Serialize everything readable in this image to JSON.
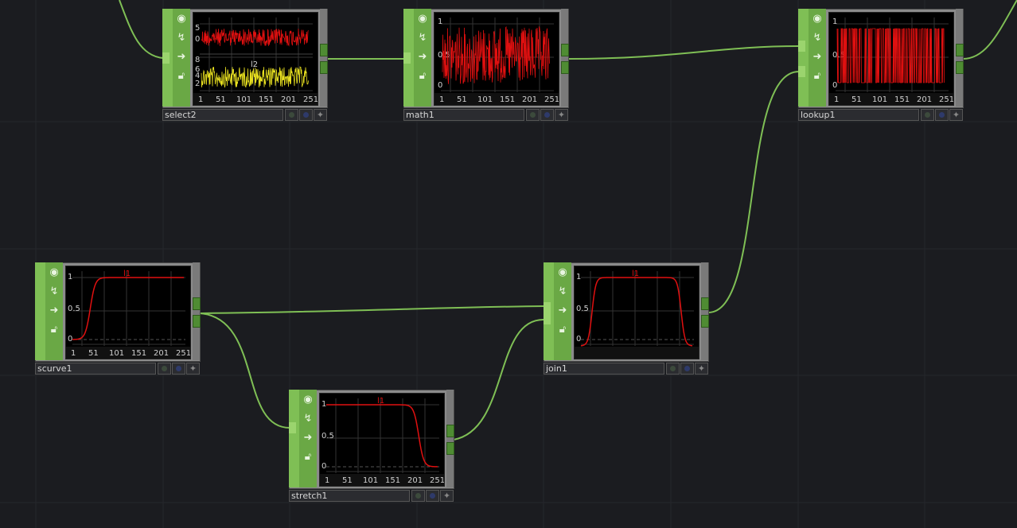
{
  "nodes": [
    {
      "id": "select2",
      "name": "select2",
      "viewer": {
        "type": "multi",
        "channel_label": "l2",
        "y_ticks_top": [
          "5",
          "0"
        ],
        "y_ticks_bottom": [
          "8",
          "6",
          "4",
          "2"
        ],
        "x_ticks": [
          "1",
          "51",
          "101",
          "151",
          "201",
          "251"
        ]
      },
      "icons": [
        "viewer-icon",
        "bypass-icon",
        "display-icon",
        "lock-icon"
      ]
    },
    {
      "id": "math1",
      "name": "math1",
      "viewer": {
        "type": "noise",
        "channel_label": "",
        "y_ticks": [
          "1",
          "0.5",
          "0"
        ],
        "x_ticks": [
          "1",
          "51",
          "101",
          "151",
          "201",
          "251"
        ]
      },
      "icons": [
        "viewer-icon",
        "bypass-icon",
        "display-icon",
        "lock-icon"
      ]
    },
    {
      "id": "lookup1",
      "name": "lookup1",
      "viewer": {
        "type": "binary",
        "channel_label": "",
        "y_ticks": [
          "1",
          "0.5",
          "0"
        ],
        "x_ticks": [
          "1",
          "51",
          "101",
          "151",
          "201",
          "251"
        ]
      },
      "icons": [
        "viewer-icon",
        "bypass-icon",
        "display-icon",
        "lock-icon"
      ]
    },
    {
      "id": "scurve1",
      "name": "scurve1",
      "viewer": {
        "type": "rise",
        "channel_label": "l1",
        "y_ticks": [
          "1",
          "0.5",
          "0"
        ],
        "x_ticks": [
          "1",
          "51",
          "101",
          "151",
          "201",
          "251"
        ]
      },
      "icons": [
        "viewer-icon",
        "bypass-icon",
        "display-icon",
        "lock-icon"
      ]
    },
    {
      "id": "join1",
      "name": "join1",
      "viewer": {
        "type": "plateau",
        "channel_label": "l1",
        "y_ticks": [
          "1",
          "0.5",
          "0"
        ],
        "x_ticks": []
      },
      "icons": [
        "viewer-icon",
        "bypass-icon",
        "display-icon",
        "lock-icon"
      ]
    },
    {
      "id": "stretch1",
      "name": "stretch1",
      "viewer": {
        "type": "fall",
        "channel_label": "l1",
        "y_ticks": [
          "1",
          "0.5",
          "0"
        ],
        "x_ticks": [
          "1",
          "51",
          "101",
          "151",
          "201",
          "251"
        ]
      },
      "icons": [
        "viewer-icon",
        "bypass-icon",
        "display-icon",
        "lock-icon"
      ]
    }
  ],
  "colors": {
    "background": "#1b1c20",
    "wire": "#7fbf55",
    "curve": "#e01010",
    "curve_secondary": "#e8e020",
    "viewer_bg": "#000000"
  }
}
